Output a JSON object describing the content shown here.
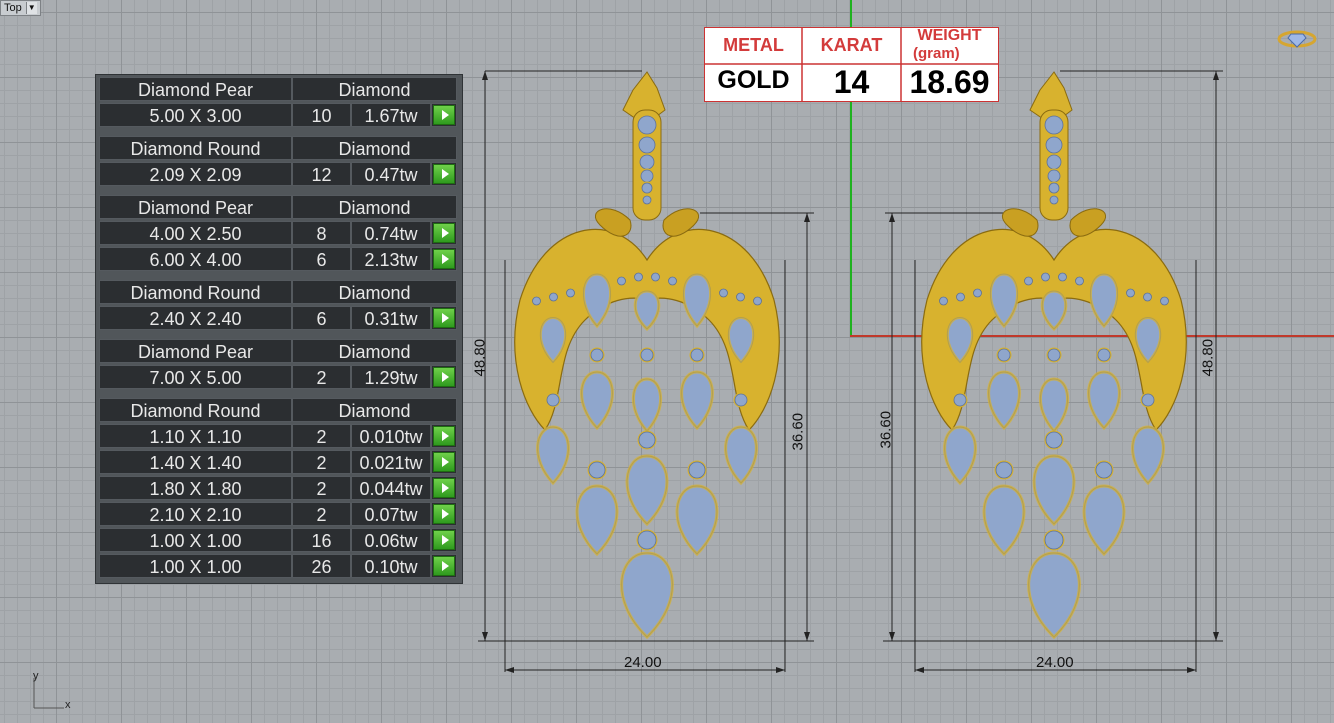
{
  "viewport": {
    "name": "Top"
  },
  "axis_labels": {
    "x": "x",
    "y": "y"
  },
  "diamond_table": [
    {
      "type": "Diamond Pear",
      "header": "Diamond",
      "rows": [
        {
          "size": "5.00 X 3.00",
          "qty": "10",
          "tw": "1.67tw"
        }
      ]
    },
    {
      "type": "Diamond Round",
      "header": "Diamond",
      "rows": [
        {
          "size": "2.09 X 2.09",
          "qty": "12",
          "tw": "0.47tw"
        }
      ]
    },
    {
      "type": "Diamond Pear",
      "header": "Diamond",
      "rows": [
        {
          "size": "4.00 X 2.50",
          "qty": "8",
          "tw": "0.74tw"
        },
        {
          "size": "6.00 X 4.00",
          "qty": "6",
          "tw": "2.13tw"
        }
      ]
    },
    {
      "type": "Diamond Round",
      "header": "Diamond",
      "rows": [
        {
          "size": "2.40 X 2.40",
          "qty": "6",
          "tw": "0.31tw"
        }
      ]
    },
    {
      "type": "Diamond Pear",
      "header": "Diamond",
      "rows": [
        {
          "size": "7.00 X 5.00",
          "qty": "2",
          "tw": "1.29tw"
        }
      ]
    },
    {
      "type": "Diamond Round",
      "header": "Diamond",
      "rows": [
        {
          "size": "1.10 X 1.10",
          "qty": "2",
          "tw": "0.010tw"
        },
        {
          "size": "1.40 X 1.40",
          "qty": "2",
          "tw": "0.021tw"
        },
        {
          "size": "1.80 X 1.80",
          "qty": "2",
          "tw": "0.044tw"
        },
        {
          "size": "2.10 X 2.10",
          "qty": "2",
          "tw": "0.07tw"
        },
        {
          "size": "1.00 X 1.00",
          "qty": "16",
          "tw": "0.06tw"
        },
        {
          "size": "1.00 X 1.00",
          "qty": "26",
          "tw": "0.10tw"
        }
      ]
    }
  ],
  "info_box": {
    "metal_label": "METAL",
    "karat_label": "KARAT",
    "weight_label": "WEIGHT",
    "weight_unit": "(gram)",
    "metal_value": "GOLD",
    "karat_value": "14",
    "weight_value": "18.69"
  },
  "dimensions": {
    "left_height_total": "48.80",
    "left_height_body": "36.60",
    "left_width": "24.00",
    "right_height_total": "48.80",
    "right_height_body": "36.60",
    "right_width": "24.00"
  },
  "colors": {
    "gold": "#d8b22e",
    "gem": "#8fa6cc",
    "accent_red": "#d33b3b",
    "grid": "#a9adb1"
  }
}
